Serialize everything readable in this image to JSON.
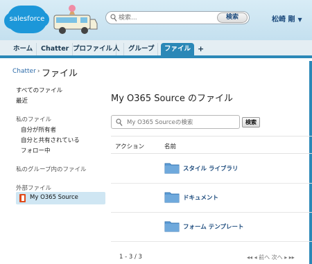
{
  "header": {
    "logo_text": "salesforce",
    "search_placeholder": "検索...",
    "search_button": "検索",
    "user_name": "松崎 剛",
    "user_caret": "▼"
  },
  "tabs": [
    {
      "label": "ホーム"
    },
    {
      "label": "Chatter"
    },
    {
      "label": "プロファイル"
    },
    {
      "label": "人"
    },
    {
      "label": "グループ"
    },
    {
      "label": "ファイル",
      "active": true
    },
    {
      "label": "+"
    }
  ],
  "breadcrumb": {
    "link": "Chatter",
    "separator": "›",
    "title": "ファイル"
  },
  "sidebar": {
    "items": [
      {
        "label": "すべてのファイル"
      },
      {
        "label": "最近"
      },
      {
        "label": "私のファイル"
      },
      {
        "label": "自分が所有者"
      },
      {
        "label": "自分と共有されている"
      },
      {
        "label": "フォロー中"
      },
      {
        "label": "私のグループ内のファイル"
      },
      {
        "label": "外部ファイル"
      },
      {
        "label": "My O365 Source"
      }
    ]
  },
  "main": {
    "title": "My O365 Source のファイル",
    "search_placeholder": "My O365 Sourceの検索",
    "search_button": "検索",
    "columns": [
      "アクション",
      "名前"
    ],
    "rows": [
      {
        "name": "スタイル ライブラリ"
      },
      {
        "name": "ドキュメント"
      },
      {
        "name": "フォーム テンプレート"
      }
    ],
    "count": "1 - 3 / 3",
    "pager": "◂◂ ◂ 前へ 次へ ▸ ▸▸"
  },
  "colors": {
    "accent": "#2b88b7",
    "link": "#1e4c7e",
    "folder": "#5b9bd5"
  }
}
